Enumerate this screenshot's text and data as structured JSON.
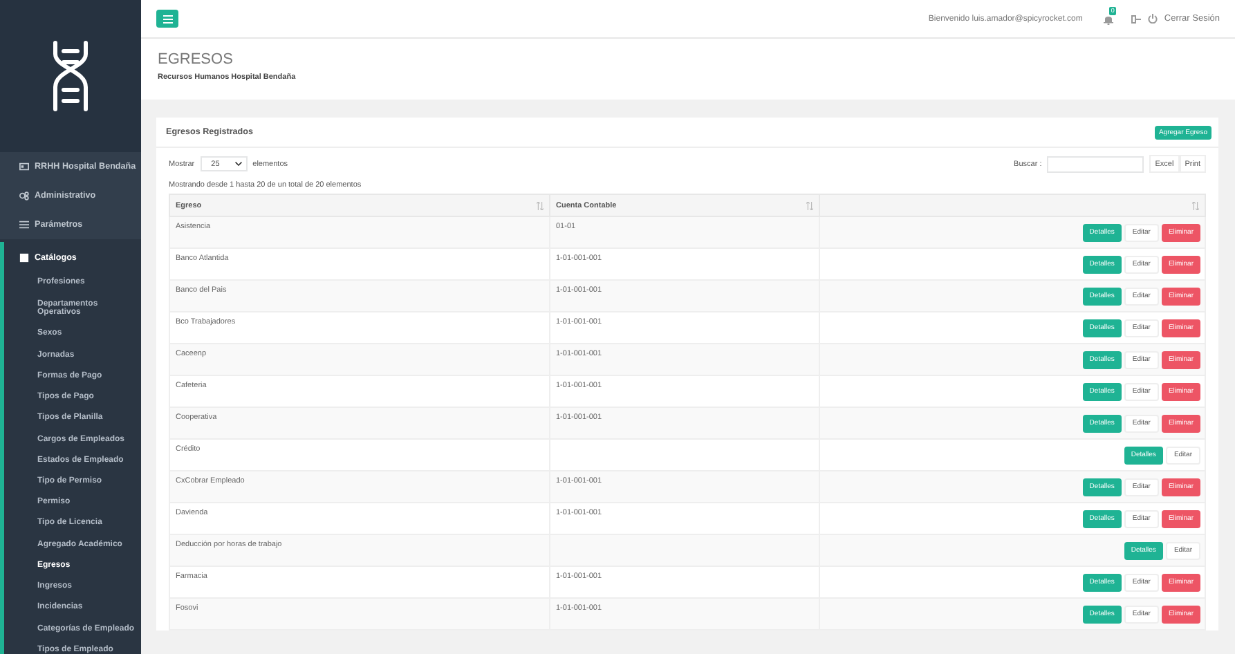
{
  "sidebar": {
    "items": [
      {
        "label": "RRHH Hospital Bendaña",
        "expanded": false
      },
      {
        "label": "Administrativo",
        "expanded": false
      },
      {
        "label": "Parámetros",
        "expanded": false
      },
      {
        "label": "Catálogos",
        "expanded": true,
        "children": [
          {
            "label": "Profesiones",
            "selected": false
          },
          {
            "label": "Departamentos Operativos",
            "selected": false
          },
          {
            "label": "Sexos",
            "selected": false
          },
          {
            "label": "Jornadas",
            "selected": false
          },
          {
            "label": "Formas de Pago",
            "selected": false
          },
          {
            "label": "Tipos de Pago",
            "selected": false
          },
          {
            "label": "Tipos de Planilla",
            "selected": false
          },
          {
            "label": "Cargos de Empleados",
            "selected": false
          },
          {
            "label": "Estados de Empleado",
            "selected": false
          },
          {
            "label": "Tipo de Permiso",
            "selected": false
          },
          {
            "label": "Permiso",
            "selected": false
          },
          {
            "label": "Tipo de Licencia",
            "selected": false
          },
          {
            "label": "Agregado Académico",
            "selected": false
          },
          {
            "label": "Egresos",
            "selected": true
          },
          {
            "label": "Ingresos",
            "selected": false
          },
          {
            "label": "Incidencias",
            "selected": false
          },
          {
            "label": "Categorías de Empleado",
            "selected": false
          },
          {
            "label": "Tipos de Empleado",
            "selected": false
          }
        ]
      }
    ]
  },
  "topbar": {
    "welcome": "Bienvenido luis.amador@spicyrocket.com",
    "notification_count": "0",
    "logout": "Cerrar Sesión"
  },
  "page": {
    "title": "EGRESOS",
    "subtitle": "Recursos Humanos Hospital Bendaña"
  },
  "card": {
    "title": "Egresos Registrados",
    "add_button": "Agregar Egreso",
    "show_label": "Mostrar",
    "page_size": "25",
    "entries_label": "elementos",
    "search_label": "Buscar :",
    "export_buttons": [
      "Excel",
      "Print"
    ],
    "info": "Mostrando desde 1 hasta 20 de un total de 20 elementos"
  },
  "table": {
    "columns": [
      "Egreso",
      "Cuenta Contable",
      ""
    ],
    "rows": [
      {
        "egreso": "Asistencia",
        "cuenta": "01-01",
        "actions": [
          {
            "kind": "details",
            "label": "Detalles"
          },
          {
            "kind": "edit",
            "label": "Editar"
          },
          {
            "kind": "delete",
            "label": "Eliminar"
          }
        ]
      },
      {
        "egreso": "Banco Atlantida",
        "cuenta": "1-01-001-001",
        "actions": [
          {
            "kind": "details",
            "label": "Detalles"
          },
          {
            "kind": "edit",
            "label": "Editar"
          },
          {
            "kind": "delete",
            "label": "Eliminar"
          }
        ]
      },
      {
        "egreso": "Banco del Pais",
        "cuenta": "1-01-001-001",
        "actions": [
          {
            "kind": "details",
            "label": "Detalles"
          },
          {
            "kind": "edit",
            "label": "Editar"
          },
          {
            "kind": "delete",
            "label": "Eliminar"
          }
        ]
      },
      {
        "egreso": "Bco Trabajadores",
        "cuenta": "1-01-001-001",
        "actions": [
          {
            "kind": "details",
            "label": "Detalles"
          },
          {
            "kind": "edit",
            "label": "Editar"
          },
          {
            "kind": "delete",
            "label": "Eliminar"
          }
        ]
      },
      {
        "egreso": "Caceenp",
        "cuenta": "1-01-001-001",
        "actions": [
          {
            "kind": "details",
            "label": "Detalles"
          },
          {
            "kind": "edit",
            "label": "Editar"
          },
          {
            "kind": "delete",
            "label": "Eliminar"
          }
        ]
      },
      {
        "egreso": "Cafeteria",
        "cuenta": "1-01-001-001",
        "actions": [
          {
            "kind": "details",
            "label": "Detalles"
          },
          {
            "kind": "edit",
            "label": "Editar"
          },
          {
            "kind": "delete",
            "label": "Eliminar"
          }
        ]
      },
      {
        "egreso": "Cooperativa",
        "cuenta": "1-01-001-001",
        "actions": [
          {
            "kind": "details",
            "label": "Detalles"
          },
          {
            "kind": "edit",
            "label": "Editar"
          },
          {
            "kind": "delete",
            "label": "Eliminar"
          }
        ]
      },
      {
        "egreso": "Crédito",
        "cuenta": "",
        "actions": [
          {
            "kind": "details",
            "label": "Detalles"
          },
          {
            "kind": "edit",
            "label": "Editar"
          }
        ]
      },
      {
        "egreso": "CxCobrar Empleado",
        "cuenta": "1-01-001-001",
        "actions": [
          {
            "kind": "details",
            "label": "Detalles"
          },
          {
            "kind": "edit",
            "label": "Editar"
          },
          {
            "kind": "delete",
            "label": "Eliminar"
          }
        ]
      },
      {
        "egreso": "Davienda",
        "cuenta": "1-01-001-001",
        "actions": [
          {
            "kind": "details",
            "label": "Detalles"
          },
          {
            "kind": "edit",
            "label": "Editar"
          },
          {
            "kind": "delete",
            "label": "Eliminar"
          }
        ]
      },
      {
        "egreso": "Deducción por horas de trabajo",
        "cuenta": "",
        "actions": [
          {
            "kind": "details",
            "label": "Detalles"
          },
          {
            "kind": "edit",
            "label": "Editar"
          }
        ]
      },
      {
        "egreso": "Farmacia",
        "cuenta": "1-01-001-001",
        "actions": [
          {
            "kind": "details",
            "label": "Detalles"
          },
          {
            "kind": "edit",
            "label": "Editar"
          },
          {
            "kind": "delete",
            "label": "Eliminar"
          }
        ]
      },
      {
        "egreso": "Fosovi",
        "cuenta": "1-01-001-001",
        "actions": [
          {
            "kind": "details",
            "label": "Detalles"
          },
          {
            "kind": "edit",
            "label": "Editar"
          },
          {
            "kind": "delete",
            "label": "Eliminar"
          }
        ]
      }
    ]
  }
}
